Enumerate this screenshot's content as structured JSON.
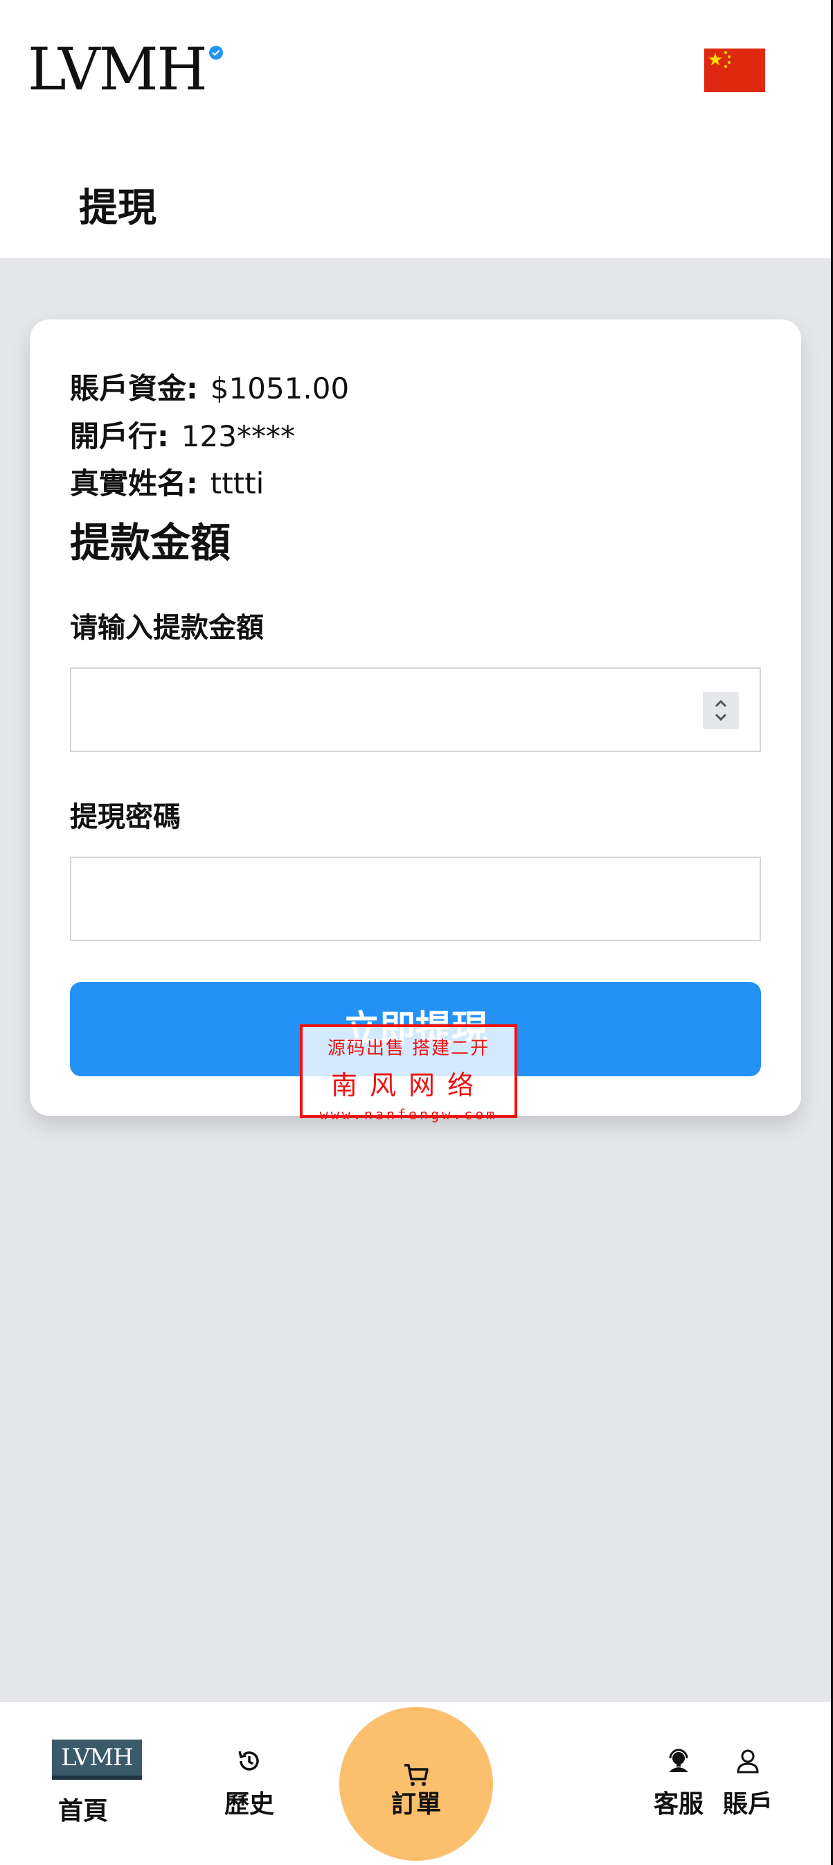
{
  "header": {
    "logo_text": "LVMH",
    "language_flag": "china-flag-icon",
    "page_title": "提現"
  },
  "account_info": {
    "balance_label": "賬戶資金:",
    "balance_value": "$1051.00",
    "bank_label": "開戶行:",
    "bank_value": "123****",
    "name_label": "真實姓名:",
    "name_value": "tttti"
  },
  "form": {
    "heading": "提款金額",
    "amount_label": "请输入提款金額",
    "amount_value": "",
    "password_label": "提現密碼",
    "password_value": "",
    "submit_label": "立即提現"
  },
  "watermark": {
    "line1": "源码出售 搭建二开",
    "line2": "南风网络",
    "line3": "www.nanfengw.com"
  },
  "bottom_nav": {
    "items": [
      {
        "label": "首頁",
        "icon": "lvmh-logo-icon"
      },
      {
        "label": "歷史",
        "icon": "history-icon"
      },
      {
        "label": "訂單",
        "icon": "cart-icon"
      },
      {
        "label": "客服",
        "icon": "support-agent-icon"
      },
      {
        "label": "賬戶",
        "icon": "user-icon"
      }
    ],
    "logo_text": "LVMH"
  },
  "colors": {
    "primary_button": "#2391f5",
    "center_nav_bg": "#fbbf6d",
    "page_bg": "#e5e7eb",
    "verified_badge": "#2196f3",
    "watermark": "#ee1111"
  }
}
